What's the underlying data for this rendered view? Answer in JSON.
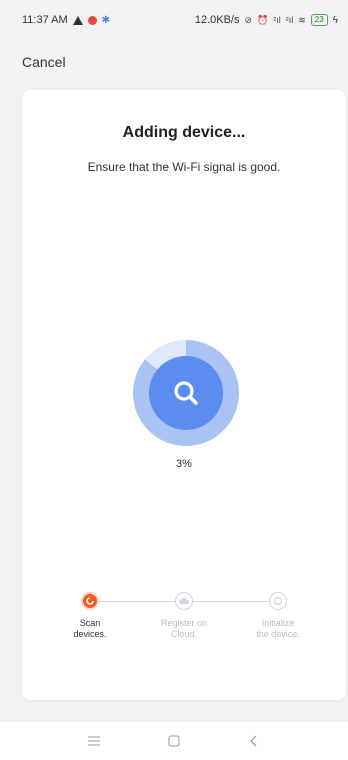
{
  "status_bar": {
    "time": "11:37 AM",
    "network_speed": "12.0KB/s",
    "signal_1": "²ıl",
    "signal_2": "²ıl",
    "battery": "23"
  },
  "header": {
    "cancel_label": "Cancel"
  },
  "main": {
    "title": "Adding device...",
    "subtitle": "Ensure that the Wi-Fi signal is good.",
    "progress_text": "3%",
    "progress_fraction": 0.03
  },
  "steps": [
    {
      "label_line1": "Scan",
      "label_line2": "devices.",
      "state": "active"
    },
    {
      "label_line1": "Register on",
      "label_line2": "Cloud.",
      "state": "inactive"
    },
    {
      "label_line1": "Initialize",
      "label_line2": "the device.",
      "state": "inactive"
    }
  ],
  "colors": {
    "accent": "#f15a24",
    "progress_blue": "#5b8def",
    "progress_light": "#a9c3f5",
    "background": "#f2f2f4"
  },
  "icons": {
    "search": "magnifier-icon",
    "nav_menu": "menu-icon",
    "nav_home": "square-home-icon",
    "nav_back": "back-chevron-icon"
  }
}
